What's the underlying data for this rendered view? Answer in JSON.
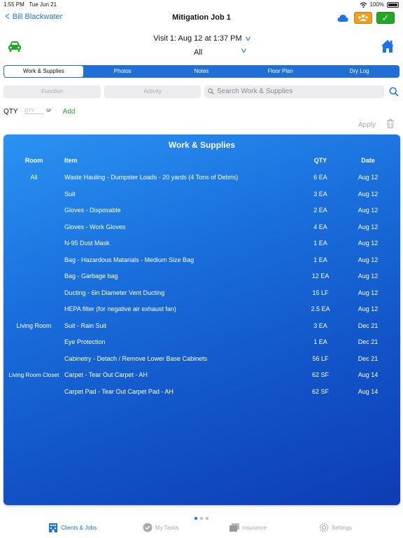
{
  "status_bar": {
    "time": "1:55 PM",
    "date": "Tue Jun 21",
    "battery": "100%"
  },
  "nav": {
    "back_label": "Bill Blackwater",
    "title": "Mitigation Job 1"
  },
  "visit": {
    "selected": "Visit 1: Aug 12 at 1:37 PM",
    "filter": "All"
  },
  "tabs": [
    "Work & Supplies",
    "Photos",
    "Notes",
    "Floor Plan",
    "Dry Log"
  ],
  "active_tab": "Work & Supplies",
  "filters": {
    "function_placeholder": "Function",
    "activity_placeholder": "Activity",
    "search_placeholder": "Search Work & Supplies"
  },
  "qty_row": {
    "label": "QTY",
    "placeholder": "QTY",
    "unit": "SF",
    "add_label": "Add"
  },
  "actions": {
    "apply_label": "Apply"
  },
  "table": {
    "title": "Work & Supplies",
    "headers": {
      "room": "Room",
      "item": "Item",
      "qty": "QTY",
      "date": "Date"
    },
    "rows": [
      {
        "room": "All",
        "item": "Waste Hauling - Dumpster Loads - 20 yards (4 Tons of Debris)",
        "qty": "6 EA",
        "date": "Aug 12"
      },
      {
        "room": "",
        "item": "Suit",
        "qty": "3 EA",
        "date": "Aug 12"
      },
      {
        "room": "",
        "item": "Gloves - Disposable",
        "qty": "2 EA",
        "date": "Aug 12"
      },
      {
        "room": "",
        "item": "Gloves - Work Gloves",
        "qty": "4 EA",
        "date": "Aug 12"
      },
      {
        "room": "",
        "item": "N-95 Dust Mask",
        "qty": "1 EA",
        "date": "Aug 12"
      },
      {
        "room": "",
        "item": "Bag - Hazardous Matarials - Medium Size Bag",
        "qty": "1 EA",
        "date": "Aug 12"
      },
      {
        "room": "",
        "item": "Bag - Garbage bag",
        "qty": "12 EA",
        "date": "Aug 12"
      },
      {
        "room": "",
        "item": "Ducting - 6in Diameter Vent Ducting",
        "qty": "15 LF",
        "date": "Aug 12"
      },
      {
        "room": "",
        "item": "HEPA filter (for negative air exhaust fan)",
        "qty": "2.5 EA",
        "date": "Aug 12"
      },
      {
        "room": "Living Room",
        "item": "Suit - Rain Suit",
        "qty": "3 EA",
        "date": "Dec 21"
      },
      {
        "room": "",
        "item": "Eye Protection",
        "qty": "1 EA",
        "date": "Dec 21"
      },
      {
        "room": "",
        "item": "Cabinetry - Detach / Remove Lower Base Cabinets",
        "qty": "56 LF",
        "date": "Dec 21"
      },
      {
        "room": "Living Room Closet",
        "item": "Carpet - Tear Out Carpet - AH",
        "qty": "62 SF",
        "date": "Aug 14"
      },
      {
        "room": "",
        "item": "Carpet Pad - Tear Out Carpet Pad - AH",
        "qty": "62 SF",
        "date": "Aug 14"
      }
    ]
  },
  "page_dots": {
    "count": 3,
    "active": 0
  },
  "tab_bar": [
    {
      "label": "Clients & Jobs",
      "icon": "building-icon",
      "active": true
    },
    {
      "label": "My Tasks",
      "icon": "checkmark-circle-icon",
      "active": false
    },
    {
      "label": "Insurance",
      "icon": "stacked-cards-icon",
      "active": false
    },
    {
      "label": "Settings",
      "icon": "gear-icon",
      "active": false
    }
  ],
  "colors": {
    "accent": "#1a73e8",
    "panel_top": "#2a93f2",
    "panel_bottom": "#0e3cb5",
    "add_green": "#22a822",
    "orange": "#f0a020"
  }
}
